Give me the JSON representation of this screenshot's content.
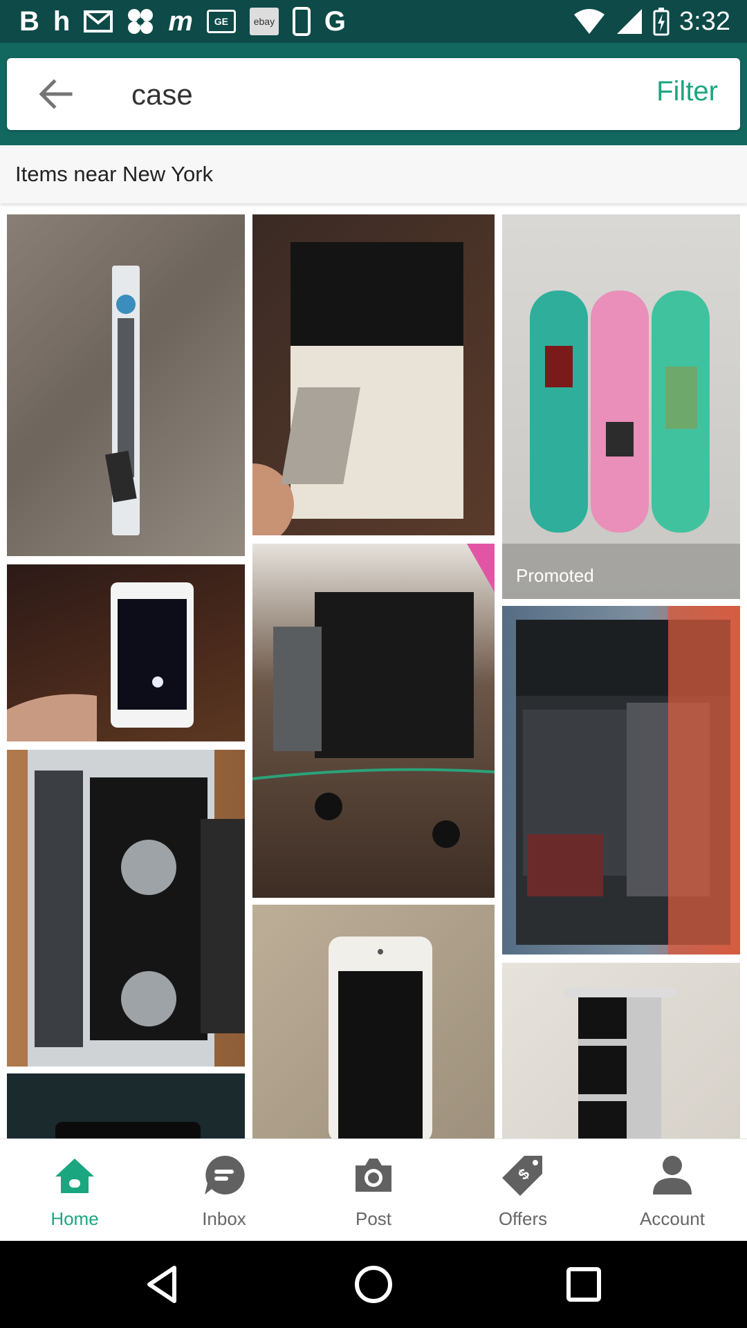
{
  "status_bar": {
    "time": "3:32",
    "left_icons": [
      "B",
      "h",
      "mail-icon",
      "windmill-icon",
      "m",
      "GE",
      "ebay",
      "phone-icon",
      "G"
    ],
    "battery_glyph": "⚡"
  },
  "search": {
    "query": "case",
    "filter_label": "Filter"
  },
  "location": {
    "text": "Items near New York"
  },
  "listings": [
    {
      "name": "monopod-listing",
      "badge": ""
    },
    {
      "name": "speck-folio-listing",
      "badge": ""
    },
    {
      "name": "skateboard-decks-listing",
      "badge": "Promoted"
    },
    {
      "name": "white-phone-listing",
      "badge": ""
    },
    {
      "name": "radio-device-listing",
      "badge": ""
    },
    {
      "name": "blackweb-folio-case-listing",
      "badge": ""
    },
    {
      "name": "dj-controller-case-listing",
      "badge": ""
    },
    {
      "name": "iphone-listing",
      "badge": ""
    },
    {
      "name": "stand-listing",
      "badge": ""
    },
    {
      "name": "dark-item-listing",
      "badge": ""
    }
  ],
  "bottom_nav": [
    {
      "label": "Home",
      "icon": "home-icon",
      "active": true
    },
    {
      "label": "Inbox",
      "icon": "chat-icon",
      "active": false
    },
    {
      "label": "Post",
      "icon": "camera-icon",
      "active": false
    },
    {
      "label": "Offers",
      "icon": "tag-icon",
      "active": false
    },
    {
      "label": "Account",
      "icon": "person-icon",
      "active": false
    }
  ],
  "colors": {
    "header": "#12675f",
    "status_bar": "#0d4a48",
    "accent": "#1aa67f"
  }
}
